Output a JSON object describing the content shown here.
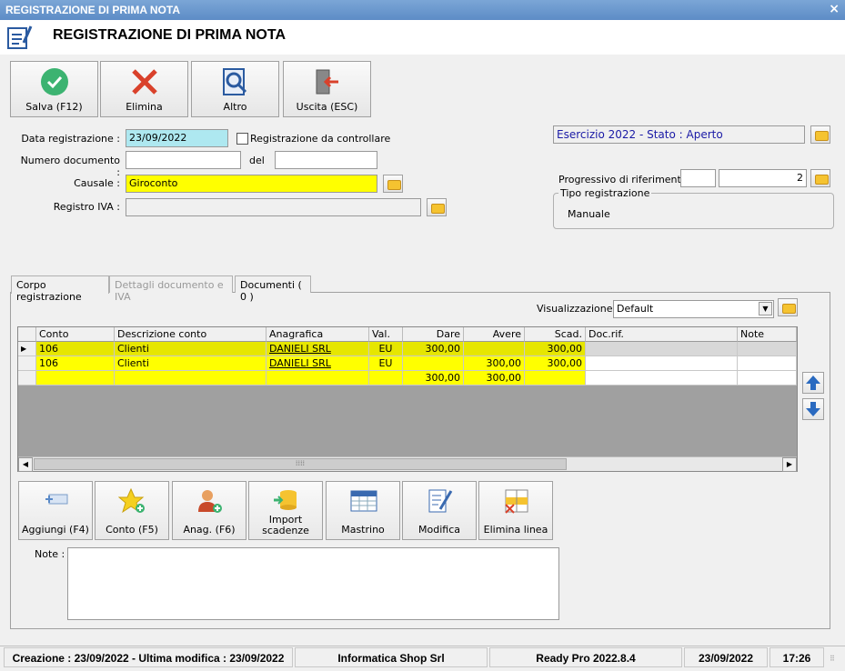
{
  "window": {
    "title": "REGISTRAZIONE DI PRIMA NOTA",
    "close": "×"
  },
  "header": {
    "title": "REGISTRAZIONE DI PRIMA NOTA"
  },
  "toolbar": {
    "save_label": "Salva (F12)",
    "delete_label": "Elimina",
    "more_label": "Altro",
    "exit_label": "Uscita (ESC)"
  },
  "form": {
    "data_registrazione_label": "Data registrazione :",
    "data_registrazione_value": "23/09/2022",
    "registrazione_controllare_label": "Registrazione da controllare",
    "numero_documento_label": "Numero documento :",
    "numero_documento_value": "",
    "del_label": "del",
    "del_value": "",
    "causale_label": "Causale :",
    "causale_value": "Giroconto",
    "registro_iva_label": "Registro IVA :",
    "registro_iva_value": ""
  },
  "right_panel": {
    "esercizio_value": "Esercizio 2022 - Stato : Aperto",
    "progressivo_label": "Progressivo di riferimento :",
    "progressivo_value1": "",
    "progressivo_value2": "2",
    "tipo_registrazione_label": "Tipo registrazione",
    "tipo_registrazione_value": "Manuale"
  },
  "tabs": [
    {
      "label": "Corpo registrazione"
    },
    {
      "label": "Dettagli documento e IVA"
    },
    {
      "label": "Documenti ( 0 )"
    }
  ],
  "visualizzazione": {
    "label": "Visualizzazione :",
    "value": "Default"
  },
  "grid": {
    "columns": [
      "Conto",
      "Descrizione conto",
      "Anagrafica",
      "Val.",
      "Dare",
      "Avere",
      "Scad.",
      "Doc.rif.",
      "Note"
    ],
    "rows": [
      {
        "conto": "106",
        "descrizione": "Clienti",
        "anagrafica": "DANIELI SRL",
        "val": "EU",
        "dare": "300,00",
        "avere": "",
        "scad": "300,00",
        "docrif": "",
        "note": ""
      },
      {
        "conto": "106",
        "descrizione": "Clienti",
        "anagrafica": "DANIELI SRL",
        "val": "EU",
        "dare": "",
        "avere": "300,00",
        "scad": "300,00",
        "docrif": "",
        "note": ""
      }
    ],
    "totals": {
      "dare": "300,00",
      "avere": "300,00"
    }
  },
  "actions": {
    "aggiungi": "Aggiungi (F4)",
    "conto": "Conto (F5)",
    "anag": "Anag. (F6)",
    "import_line1": "Import",
    "import_line2": "scadenze",
    "mastrino": "Mastrino",
    "modifica": "Modifica",
    "elimina_linea": "Elimina linea"
  },
  "note": {
    "label": "Note :",
    "value": ""
  },
  "status": {
    "creazione": "Creazione : 23/09/2022 - Ultima modifica : 23/09/2022",
    "company": "Informatica Shop Srl",
    "version": "Ready Pro 2022.8.4",
    "date": "23/09/2022",
    "time": "17:26"
  },
  "colors": {
    "yellow": "#ffff00",
    "selected_yellow": "#e6e600",
    "cyan": "#aee8f0",
    "blue_text": "#1a1aa6"
  }
}
